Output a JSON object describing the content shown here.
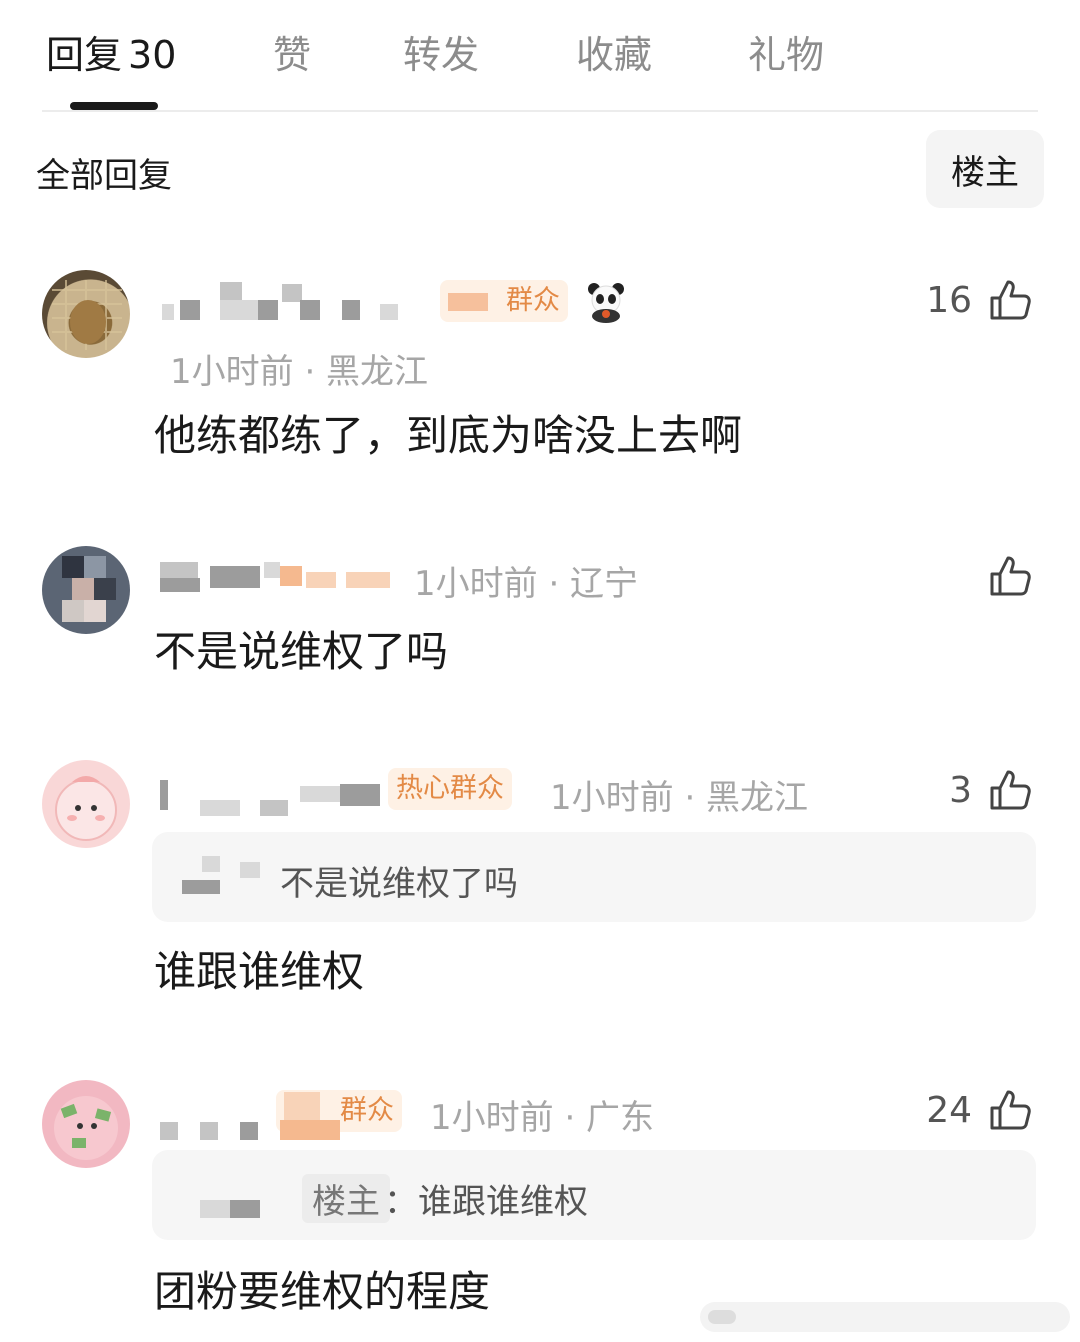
{
  "tabs": [
    {
      "label": "回复",
      "count": "30"
    },
    {
      "label": "赞"
    },
    {
      "label": "转发"
    },
    {
      "label": "收藏"
    },
    {
      "label": "礼物"
    }
  ],
  "filter": {
    "title": "全部回复",
    "op_button": "楼主"
  },
  "comments": [
    {
      "badge": "群众",
      "meta": "1小时前 · 黑龙江",
      "text": "他练都练了，到底为啥没上去啊",
      "likes": "16"
    },
    {
      "meta": "1小时前 · 辽宁",
      "text": "不是说维权了吗",
      "likes": ""
    },
    {
      "badge": "热心群众",
      "meta": "1小时前 · 黑龙江",
      "quote": "不是说维权了吗",
      "text": "谁跟谁维权",
      "likes": "3"
    },
    {
      "badge": "群众",
      "meta": "1小时前 · 广东",
      "quote_tag": "楼主",
      "quote": "：谁跟谁维权",
      "text": "团粉要维权的程度",
      "likes": "24"
    }
  ],
  "colors": {
    "badge_text": "#e38a46",
    "badge_bg": "#fef1e5",
    "meta": "#a6a6a6"
  },
  "icons": {
    "like": "thumbs-up-icon",
    "badge_emoji": "panda-emoji-icon"
  }
}
